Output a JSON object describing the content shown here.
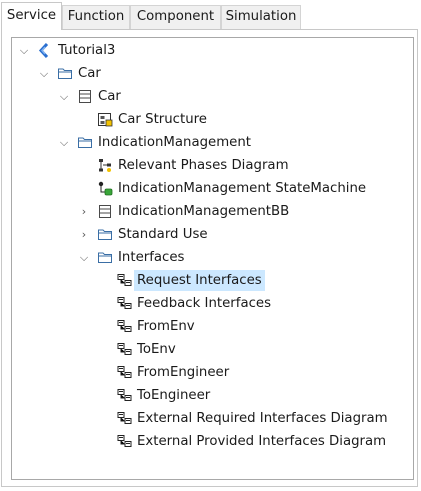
{
  "tabs": [
    {
      "label": "Service",
      "active": true
    },
    {
      "label": "Function",
      "active": false
    },
    {
      "label": "Component",
      "active": false
    },
    {
      "label": "Simulation",
      "active": false
    }
  ],
  "tree": {
    "selection_color": "#cce8ff",
    "nodes": [
      {
        "label": "Tutorial3",
        "icon": "project-icon",
        "twisty": "expanded"
      },
      {
        "label": "Car",
        "icon": "folder-icon",
        "twisty": "expanded"
      },
      {
        "label": "Car",
        "icon": "block-icon",
        "twisty": "expanded"
      },
      {
        "label": "Car Structure",
        "icon": "structure-diagram-icon",
        "twisty": "none"
      },
      {
        "label": "IndicationManagement",
        "icon": "folder-icon",
        "twisty": "expanded"
      },
      {
        "label": "Relevant Phases Diagram",
        "icon": "phases-diagram-icon",
        "twisty": "none"
      },
      {
        "label": "IndicationManagement StateMachine",
        "icon": "state-machine-icon",
        "twisty": "none"
      },
      {
        "label": "IndicationManagementBB",
        "icon": "block-icon",
        "twisty": "collapsed"
      },
      {
        "label": "Standard Use",
        "icon": "folder-icon",
        "twisty": "collapsed"
      },
      {
        "label": "Interfaces",
        "icon": "folder-icon",
        "twisty": "expanded"
      },
      {
        "label": "Request Interfaces",
        "icon": "interface-diagram-icon",
        "twisty": "none",
        "selected": true
      },
      {
        "label": "Feedback Interfaces",
        "icon": "interface-diagram-icon",
        "twisty": "none"
      },
      {
        "label": "FromEnv",
        "icon": "interface-diagram-icon",
        "twisty": "none"
      },
      {
        "label": "ToEnv",
        "icon": "interface-diagram-icon",
        "twisty": "none"
      },
      {
        "label": "FromEngineer",
        "icon": "interface-diagram-icon",
        "twisty": "none"
      },
      {
        "label": "ToEngineer",
        "icon": "interface-diagram-icon",
        "twisty": "none"
      },
      {
        "label": "External Required Interfaces Diagram",
        "icon": "interface-diagram-icon",
        "twisty": "none"
      },
      {
        "label": "External Provided Interfaces Diagram",
        "icon": "interface-diagram-icon",
        "twisty": "none"
      }
    ]
  }
}
